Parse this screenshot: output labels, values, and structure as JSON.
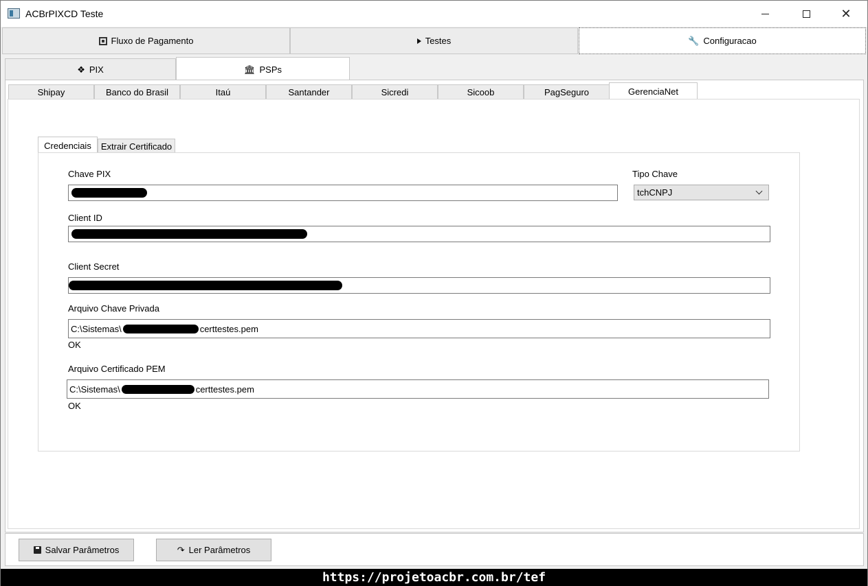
{
  "window": {
    "title": "ACBrPIXCD Teste"
  },
  "top_tabs": [
    {
      "label": "Fluxo de Pagamento",
      "icon": "qr-code-icon"
    },
    {
      "label": "Testes",
      "icon": "play-icon"
    },
    {
      "label": "Configuracao",
      "icon": "wrench-icon"
    }
  ],
  "sub_tabs": [
    {
      "label": "PIX",
      "icon": "pix-icon"
    },
    {
      "label": "PSPs",
      "icon": "bank-icon"
    }
  ],
  "psp_tabs": [
    "Shipay",
    "Banco do Brasil",
    "Itaú",
    "Santander",
    "Sicredi",
    "Sicoob",
    "PagSeguro",
    "GerenciaNet"
  ],
  "cred_tabs": [
    "Credenciais",
    "Extrair Certificado"
  ],
  "form": {
    "chave_pix_label": "Chave PIX",
    "tipo_chave_label": "Tipo Chave",
    "tipo_chave_value": "tchCNPJ",
    "client_id_label": "Client ID",
    "client_secret_label": "Client Secret",
    "arquivo_chave_label": "Arquivo Chave Privada",
    "arquivo_chave_prefix": "C:\\Sistemas\\",
    "arquivo_chave_suffix": "certtestes.pem",
    "arquivo_chave_status": "OK",
    "arquivo_cert_label": "Arquivo Certificado PEM",
    "arquivo_cert_prefix": "C:\\Sistemas\\",
    "arquivo_cert_suffix": "certtestes.pem",
    "arquivo_cert_status": "OK"
  },
  "buttons": {
    "salvar": "Salvar Parâmetros",
    "ler": "Ler Parâmetros"
  },
  "footer": {
    "url": "https://projetoacbr.com.br/tef"
  }
}
